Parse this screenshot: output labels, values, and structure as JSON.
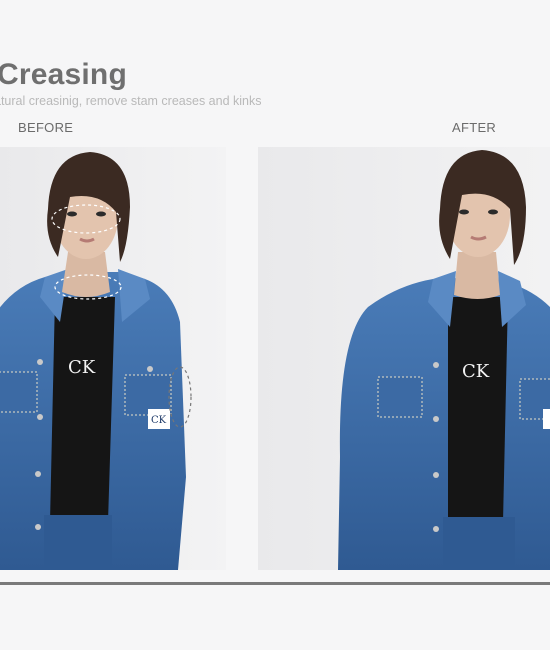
{
  "header": {
    "title": "Creasing",
    "subtitle": "atural creasinig, remove stam creases and kinks"
  },
  "comparison": {
    "before_label": "BEFORE",
    "after_label": "AFTER"
  },
  "colors": {
    "title": "#6f6f6f",
    "subtitle": "#b9b9b9",
    "denim": "#3f6ea8",
    "divider": "#7a7a7a"
  }
}
